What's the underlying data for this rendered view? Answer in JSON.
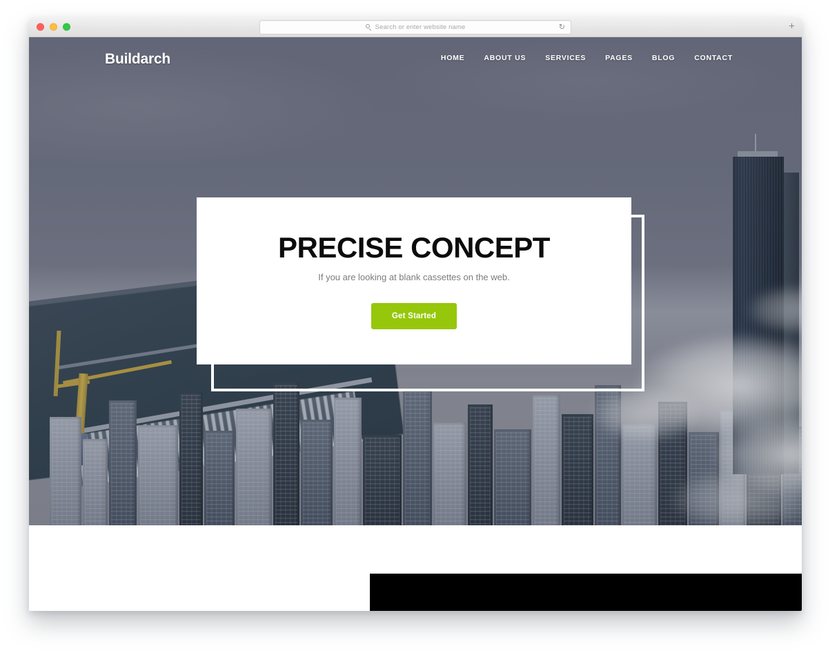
{
  "browser": {
    "traffic_lights": [
      {
        "name": "close",
        "color": "#fc605c"
      },
      {
        "name": "minimize",
        "color": "#fdbc40"
      },
      {
        "name": "maximize",
        "color": "#34c749"
      }
    ],
    "address_bar": {
      "value": "",
      "placeholder": "Search or enter website name",
      "search_icon": "search-icon",
      "reload_icon": "↻",
      "reload_glyph_name": "reload-icon"
    },
    "new_tab_label": "+"
  },
  "site": {
    "brand": "Buildarch",
    "nav": [
      {
        "label": "HOME",
        "href": "#"
      },
      {
        "label": "ABOUT US",
        "href": "#"
      },
      {
        "label": "SERVICES",
        "href": "#"
      },
      {
        "label": "PAGES",
        "href": "#"
      },
      {
        "label": "BLOG",
        "href": "#"
      },
      {
        "label": "CONTACT",
        "href": "#"
      }
    ],
    "hero": {
      "title": "PRECISE CONCEPT",
      "subtitle": "If you are looking at blank cassettes on the web.",
      "cta_label": "Get Started",
      "background_description": "Aerial photo of a dense city skyline with waterfront, marina and a construction crane, partly covered by fog"
    }
  },
  "colors": {
    "accent_green": "#96c70b",
    "hero_overlay": "#5f6475",
    "card_background": "#ffffff",
    "title_text": "#0c0c0c",
    "subtitle_text": "#7b7b7b",
    "band_black": "#000000"
  }
}
